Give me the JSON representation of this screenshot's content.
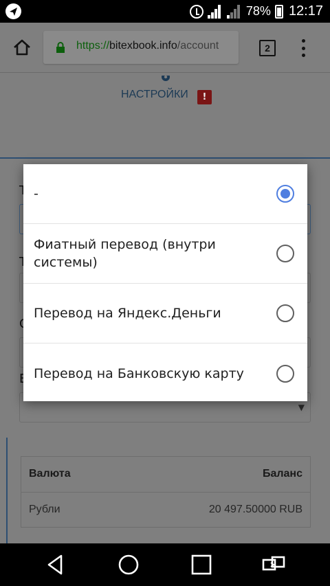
{
  "status_bar": {
    "battery": "78%",
    "time": "12:17"
  },
  "browser": {
    "url_scheme": "https://",
    "url_host": "bitexbook.info",
    "url_path": "/account",
    "tab_count": "2"
  },
  "page": {
    "settings_link": "НАСТРОЙКИ",
    "alert_badge": "!",
    "form_letters": [
      "T",
      "T",
      "С",
      "В"
    ],
    "select_arrow": "▼",
    "balance_table": {
      "headers": [
        "Валюта",
        "Баланс"
      ],
      "rows": [
        [
          "Рубли",
          "20 497.50000 RUB"
        ]
      ]
    }
  },
  "dialog": {
    "options": [
      {
        "label": "-",
        "selected": true
      },
      {
        "label": "Фиатный перевод (внутри системы)",
        "selected": false
      },
      {
        "label": "Перевод на Яндекс.Деньги",
        "selected": false
      },
      {
        "label": "Перевод на Банковскую карту",
        "selected": false
      }
    ]
  },
  "colors": {
    "radio_selected": "#4f7ee0",
    "scrim": "#7f7f7f"
  },
  "icons": {
    "status_left": "telegram-icon",
    "alarm": "alarm-icon",
    "home": "home-icon",
    "lock": "lock-icon",
    "menu": "overflow-menu-icon",
    "nav": [
      "back-icon",
      "home-circle-icon",
      "recents-icon",
      "rotate-icon"
    ]
  }
}
